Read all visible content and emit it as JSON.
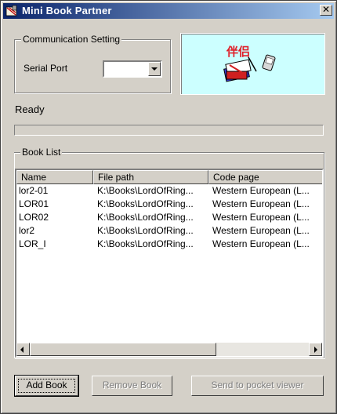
{
  "window": {
    "title": "Mini Book Partner",
    "close_label": "✕"
  },
  "communication": {
    "group_label": "Communication Setting",
    "serial_port_label": "Serial Port",
    "serial_port_value": ""
  },
  "status": {
    "text": "Ready",
    "progress": 0
  },
  "book_list": {
    "group_label": "Book List",
    "columns": [
      "Name",
      "File path",
      "Code page"
    ],
    "rows": [
      {
        "name": "lor2-01",
        "path": "K:\\Books\\LordOfRing...",
        "codepage": "Western European (L..."
      },
      {
        "name": "LOR01",
        "path": "K:\\Books\\LordOfRing...",
        "codepage": "Western European (L..."
      },
      {
        "name": "LOR02",
        "path": "K:\\Books\\LordOfRing...",
        "codepage": "Western European (L..."
      },
      {
        "name": "lor2",
        "path": "K:\\Books\\LordOfRing...",
        "codepage": "Western European (L..."
      },
      {
        "name": "LOR_I",
        "path": "K:\\Books\\LordOfRing...",
        "codepage": "Western European (L..."
      }
    ]
  },
  "buttons": {
    "add": "Add Book",
    "remove": "Remove Book",
    "send": "Send to pocket viewer"
  },
  "logo": {
    "chinese_text": "伴侣"
  },
  "colors": {
    "title_start": "#0a246a",
    "title_end": "#a6caf0",
    "logo_bg": "#ccffff",
    "logo_text": "#e0202a"
  }
}
